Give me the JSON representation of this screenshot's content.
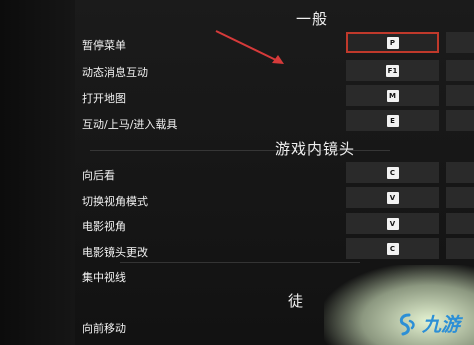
{
  "sections": {
    "general": "一般",
    "camera": "游戏内镜头",
    "walk_partial": "徒"
  },
  "rows": [
    {
      "label": "暂停菜单",
      "key": "P",
      "selected": true
    },
    {
      "label": "动态消息互动",
      "key": "F1",
      "selected": false
    },
    {
      "label": "打开地图",
      "key": "M",
      "selected": false
    },
    {
      "label": "互动/上马/进入载具",
      "key": "E",
      "selected": false
    },
    {
      "label": "向后看",
      "key": "C",
      "selected": false
    },
    {
      "label": "切换视角模式",
      "key": "V",
      "selected": false
    },
    {
      "label": "电影视角",
      "key": "V",
      "selected": false
    },
    {
      "label": "电影镜头更改",
      "key": "C",
      "selected": false
    },
    {
      "label": "集中视线",
      "key": "",
      "selected": false
    },
    {
      "label": "向前移动",
      "key": "",
      "selected": false
    }
  ],
  "colors": {
    "selection_border": "#c0392b",
    "annotation_arrow": "#d63a3a",
    "watermark_blue": "#2c8fd6"
  },
  "watermark": {
    "text": "九游",
    "icon": "swirl-logo-icon"
  }
}
